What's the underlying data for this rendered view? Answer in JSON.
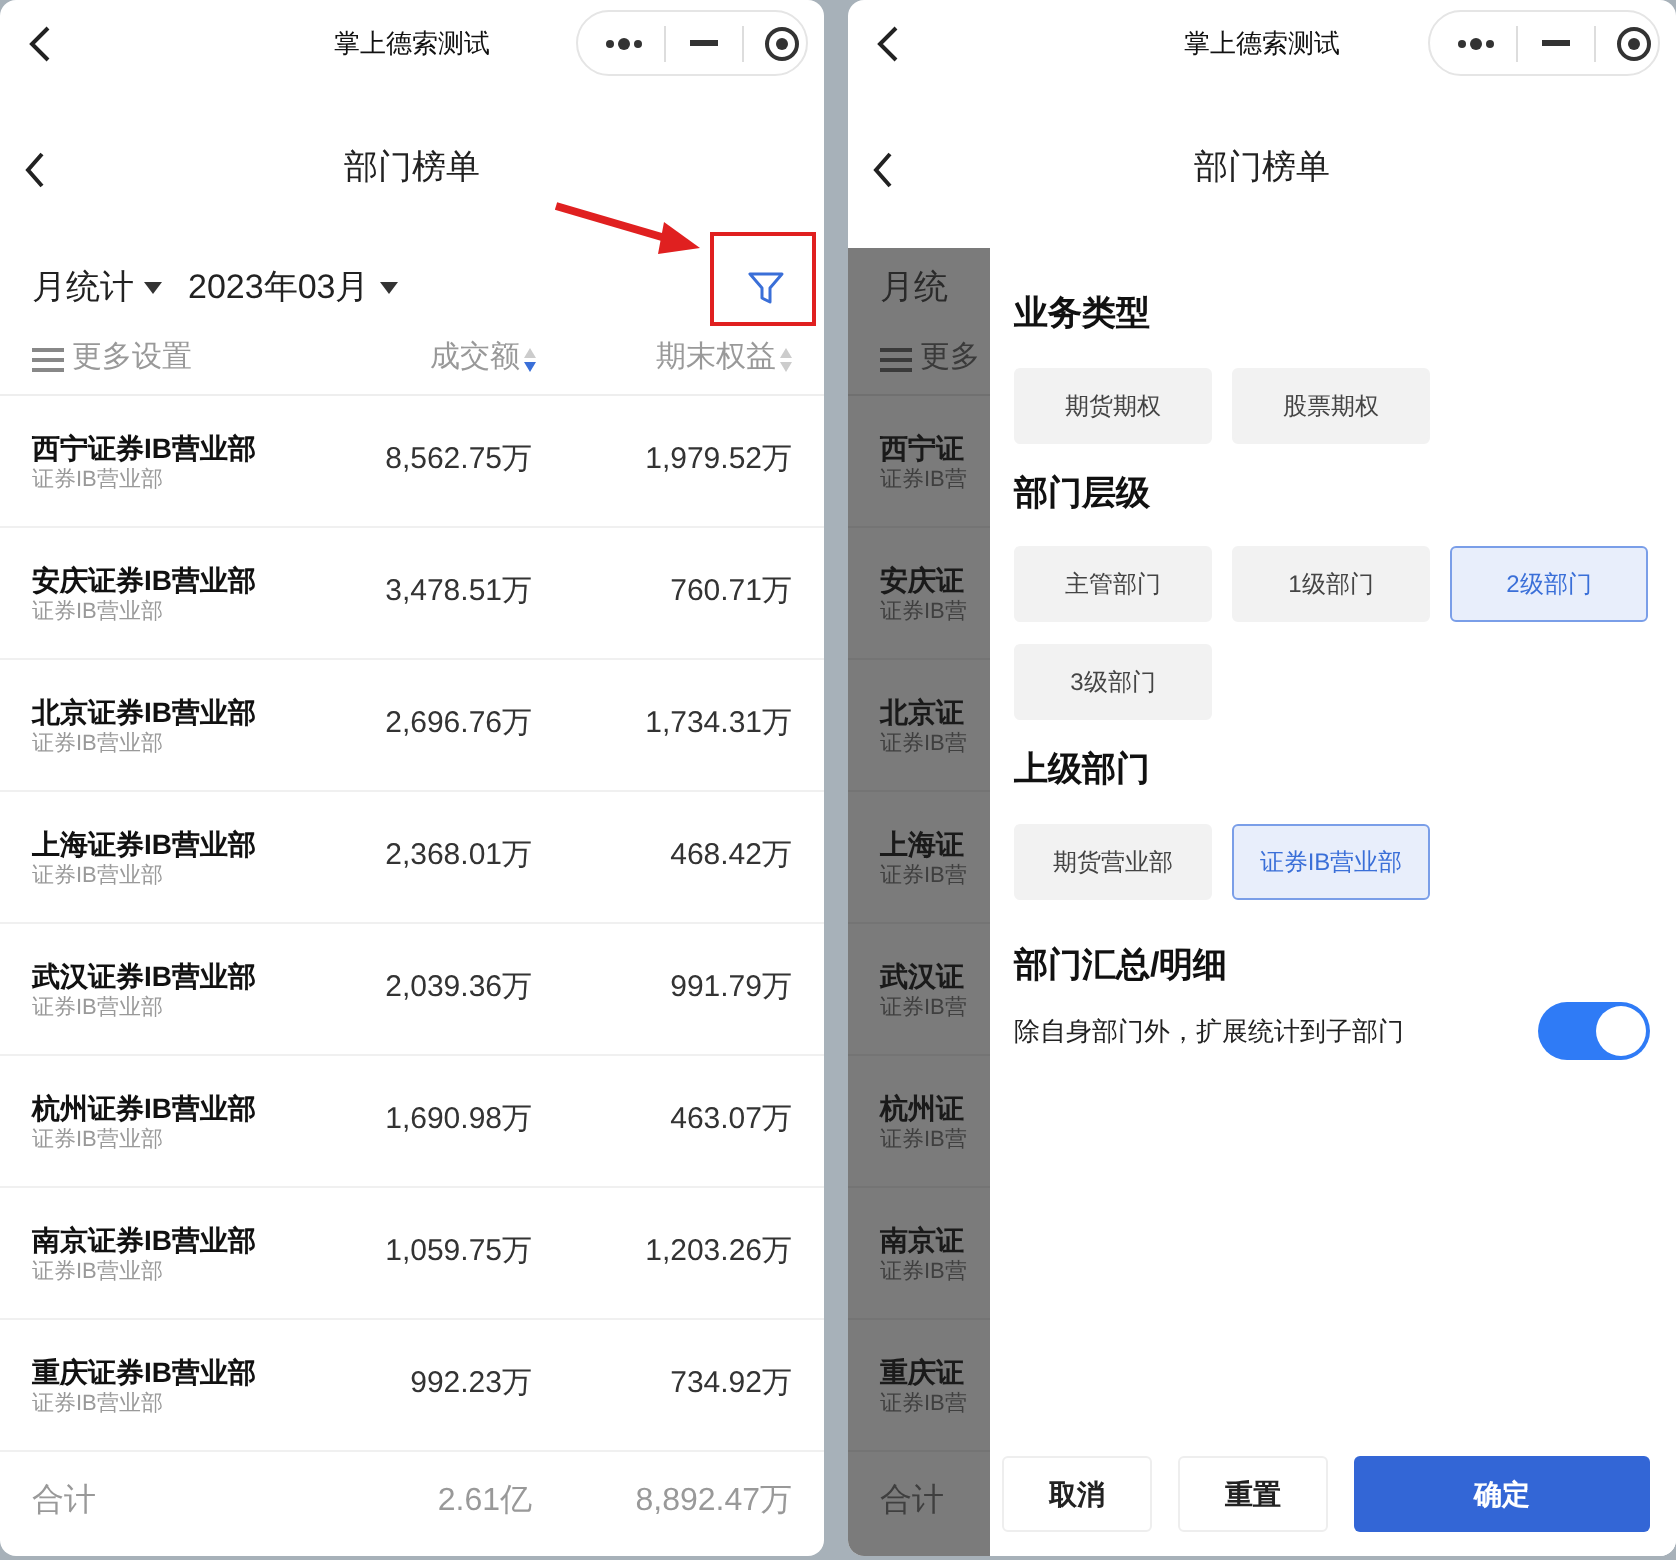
{
  "left": {
    "app_title": "掌上德索测试",
    "page_title": "部门榜单",
    "period": "月统计",
    "month": "2023年03月",
    "more_settings": "更多设置",
    "columns": [
      {
        "label": "成交额",
        "sorted": true
      },
      {
        "label": "期末权益",
        "sorted": false
      }
    ],
    "rows": [
      {
        "name": "西宁证券IB营业部",
        "type": "证券IB营业部",
        "amount": "8,562.75万",
        "equity": "1,979.52万"
      },
      {
        "name": "安庆证券IB营业部",
        "type": "证券IB营业部",
        "amount": "3,478.51万",
        "equity": "760.71万"
      },
      {
        "name": "北京证券IB营业部",
        "type": "证券IB营业部",
        "amount": "2,696.76万",
        "equity": "1,734.31万"
      },
      {
        "name": "上海证券IB营业部",
        "type": "证券IB营业部",
        "amount": "2,368.01万",
        "equity": "468.42万"
      },
      {
        "name": "武汉证券IB营业部",
        "type": "证券IB营业部",
        "amount": "2,039.36万",
        "equity": "991.79万"
      },
      {
        "name": "杭州证券IB营业部",
        "type": "证券IB营业部",
        "amount": "1,690.98万",
        "equity": "463.07万"
      },
      {
        "name": "南京证券IB营业部",
        "type": "证券IB营业部",
        "amount": "1,059.75万",
        "equity": "1,203.26万"
      },
      {
        "name": "重庆证券IB营业部",
        "type": "证券IB营业部",
        "amount": "992.23万",
        "equity": "734.92万"
      }
    ],
    "total": {
      "label": "合计",
      "amount": "2.61亿",
      "equity": "8,892.47万"
    }
  },
  "right": {
    "app_title": "掌上德索测试",
    "page_title": "部门榜单",
    "background": {
      "period": "月统",
      "more_settings": "更多",
      "rows": [
        {
          "name": "西宁证",
          "type": "证券IB营"
        },
        {
          "name": "安庆证",
          "type": "证券IB营"
        },
        {
          "name": "北京证",
          "type": "证券IB营"
        },
        {
          "name": "上海证",
          "type": "证券IB营"
        },
        {
          "name": "武汉证",
          "type": "证券IB营"
        },
        {
          "name": "杭州证",
          "type": "证券IB营"
        },
        {
          "name": "南京证",
          "type": "证券IB营"
        },
        {
          "name": "重庆证",
          "type": "证券IB营"
        }
      ],
      "total_label": "合计"
    },
    "filter": {
      "sections": [
        {
          "title": "业务类型",
          "options": [
            {
              "label": "期货期权",
              "selected": false
            },
            {
              "label": "股票期权",
              "selected": false
            }
          ]
        },
        {
          "title": "部门层级",
          "options": [
            {
              "label": "主管部门",
              "selected": false
            },
            {
              "label": "1级部门",
              "selected": false
            },
            {
              "label": "2级部门",
              "selected": true
            },
            {
              "label": "3级部门",
              "selected": false
            }
          ]
        },
        {
          "title": "上级部门",
          "options": [
            {
              "label": "期货营业部",
              "selected": false
            },
            {
              "label": "证券IB营业部",
              "selected": true
            }
          ]
        }
      ],
      "toggle": {
        "title": "部门汇总/明细",
        "label": "除自身部门外，扩展统计到子部门",
        "on": true
      }
    },
    "buttons": [
      {
        "label": "取消",
        "kind": "secondary"
      },
      {
        "label": "重置",
        "kind": "secondary"
      },
      {
        "label": "确定",
        "kind": "primary"
      }
    ]
  }
}
